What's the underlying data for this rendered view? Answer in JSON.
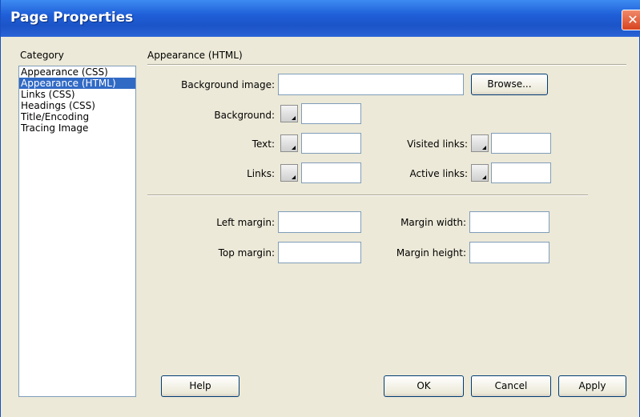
{
  "window": {
    "title": "Page Properties",
    "close_glyph": "✕"
  },
  "category": {
    "label": "Category",
    "items": [
      {
        "label": "Appearance (CSS)",
        "selected": false
      },
      {
        "label": "Appearance (HTML)",
        "selected": true
      },
      {
        "label": "Links (CSS)",
        "selected": false
      },
      {
        "label": "Headings (CSS)",
        "selected": false
      },
      {
        "label": "Title/Encoding",
        "selected": false
      },
      {
        "label": "Tracing Image",
        "selected": false
      }
    ]
  },
  "panel": {
    "heading": "Appearance (HTML)",
    "background_image": {
      "label": "Background image:",
      "value": "",
      "browse_label": "Browse..."
    },
    "background": {
      "label": "Background:",
      "value": ""
    },
    "text": {
      "label": "Text:",
      "value": ""
    },
    "links": {
      "label": "Links:",
      "value": ""
    },
    "visited_links": {
      "label": "Visited links:",
      "value": ""
    },
    "active_links": {
      "label": "Active links:",
      "value": ""
    },
    "left_margin": {
      "label": "Left margin:",
      "value": ""
    },
    "top_margin": {
      "label": "Top margin:",
      "value": ""
    },
    "margin_width": {
      "label": "Margin width:",
      "value": ""
    },
    "margin_height": {
      "label": "Margin height:",
      "value": ""
    }
  },
  "buttons": {
    "help": "Help",
    "ok": "OK",
    "cancel": "Cancel",
    "apply": "Apply"
  },
  "colors": {
    "titlebar": "#1f5fd8",
    "selection": "#316ac5",
    "dialog_bg": "#ece9d8"
  }
}
